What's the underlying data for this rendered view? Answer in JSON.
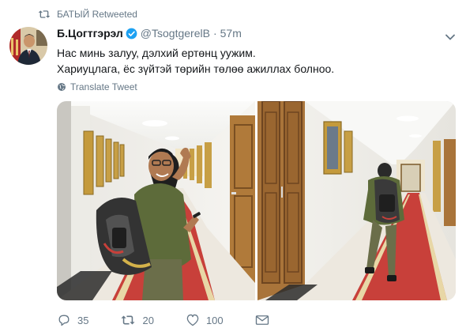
{
  "retweet_context": {
    "label": "БАТЫЙ Retweeted",
    "icon": "retweet-icon"
  },
  "tweet": {
    "author_name": "Б.Цогтгэрэл",
    "handle": "@TsogtgerelB",
    "separator": "·",
    "time": "57m",
    "line1": "Нас минь залуу, дэлхий ертөнц уужим.",
    "line2": "Хариуцлага, ёс зүйтэй төрийн төлөө ажиллах болноо.",
    "translate_label": "Translate Tweet"
  },
  "actions": {
    "reply_count": "35",
    "retweet_count": "20",
    "like_count": "100"
  },
  "colors": {
    "verified": "#1da1f2",
    "secondary_text": "#657786",
    "carpet": "#c8403a"
  }
}
